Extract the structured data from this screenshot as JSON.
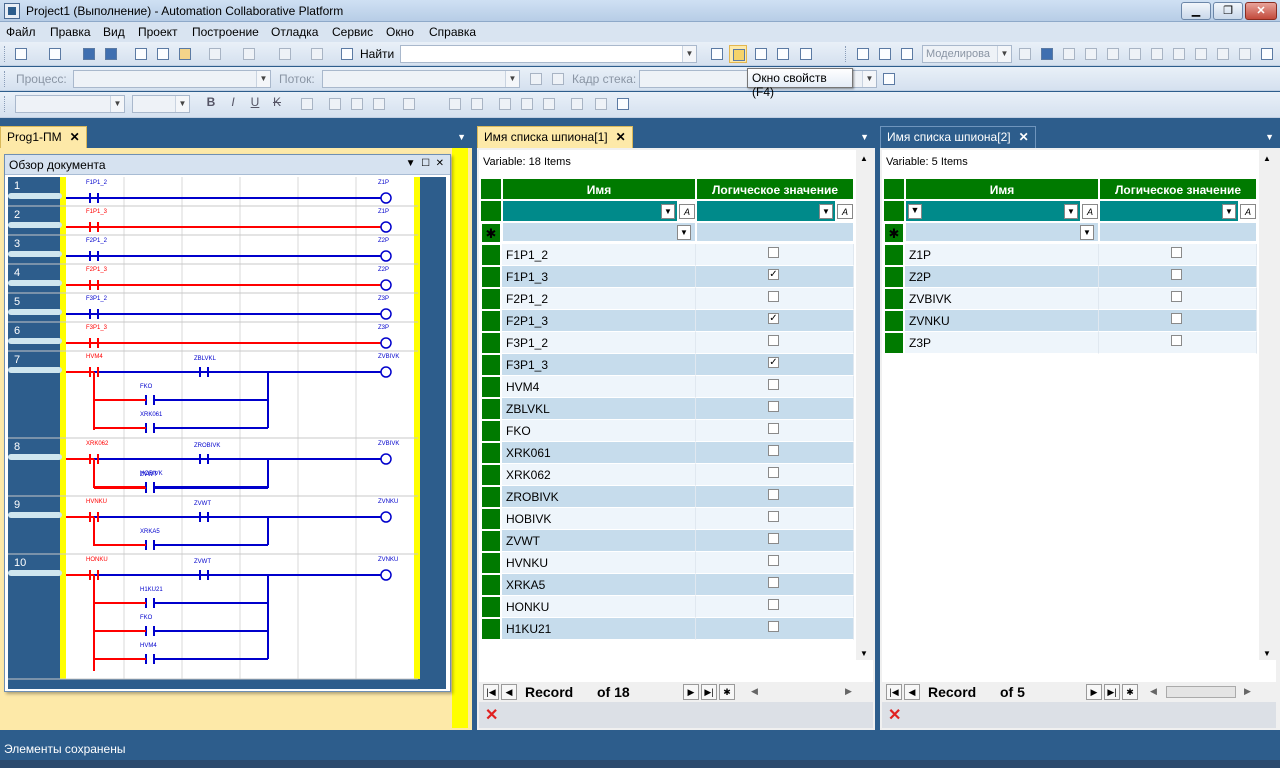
{
  "window": {
    "title": "Project1 (Выполнение) - Automation Collaborative Platform",
    "min": "▁",
    "max": "❐",
    "close": "✕"
  },
  "menu": [
    "Файл",
    "Правка",
    "Вид",
    "Проект",
    "Построение",
    "Отладка",
    "Сервис",
    "Окно",
    "Справка"
  ],
  "toolbar1": {
    "find_label": "Найти",
    "find_value": "",
    "model_combo": "Моделирова"
  },
  "toolbar2": {
    "process_label": "Процесс:",
    "process_value": "",
    "stream_label": "Поток:",
    "stream_value": "",
    "stack_label": "Кадр стека:",
    "stack_value": ""
  },
  "toolbar3": {
    "font": "",
    "size": "",
    "bold": "B",
    "italic": "I",
    "underline": "U",
    "strike": "K"
  },
  "tooltip": "Окно свойств (F4)",
  "left_panel": {
    "tab": "Prog1-ПМ",
    "overview_title": "Обзор документа",
    "rungs": [
      {
        "n": "1",
        "contacts": [
          "F1P1_2"
        ],
        "coil": "Z1P",
        "state": "blue"
      },
      {
        "n": "2",
        "contacts": [
          "F1P1_3"
        ],
        "coil": "Z1P",
        "state": "red"
      },
      {
        "n": "3",
        "contacts": [
          "F2P1_2"
        ],
        "coil": "Z2P",
        "state": "blue"
      },
      {
        "n": "4",
        "contacts": [
          "F2P1_3"
        ],
        "coil": "Z2P",
        "state": "red"
      },
      {
        "n": "5",
        "contacts": [
          "F3P1_2"
        ],
        "coil": "Z3P",
        "state": "blue"
      },
      {
        "n": "6",
        "contacts": [
          "F3P1_3"
        ],
        "coil": "Z3P",
        "state": "red"
      },
      {
        "n": "7",
        "contacts": [
          "HVM4",
          "ZBLVKL",
          "FKO",
          "XRK061"
        ],
        "coil": "ZVBIVK",
        "state": "mixed"
      },
      {
        "n": "8",
        "contacts": [
          "XRK062",
          "ZROBIVK",
          "HOBIVK",
          "ZVWT"
        ],
        "coil": "ZVBIVK",
        "state": "mixed"
      },
      {
        "n": "9",
        "contacts": [
          "HVNKU",
          "ZVWT",
          "XRKA5"
        ],
        "coil": "ZVNKU",
        "state": "mixed"
      },
      {
        "n": "10",
        "contacts": [
          "HONKU",
          "ZVWT",
          "H1KU21",
          "FKO",
          "HVM4"
        ],
        "coil": "ZVNKU",
        "state": "mixed"
      }
    ]
  },
  "watch1": {
    "tab": "Имя списка шпиона[1]",
    "variable_label": "Variable: 18 Items",
    "col_name": "Имя",
    "col_value": "Логическое значение",
    "rows": [
      {
        "name": "F1P1_2",
        "checked": false
      },
      {
        "name": "F1P1_3",
        "checked": true
      },
      {
        "name": "F2P1_2",
        "checked": false
      },
      {
        "name": "F2P1_3",
        "checked": true
      },
      {
        "name": "F3P1_2",
        "checked": false
      },
      {
        "name": "F3P1_3",
        "checked": true
      },
      {
        "name": "HVM4",
        "checked": false
      },
      {
        "name": "ZBLVKL",
        "checked": false
      },
      {
        "name": "FKO",
        "checked": false
      },
      {
        "name": "XRK061",
        "checked": false
      },
      {
        "name": "XRK062",
        "checked": false
      },
      {
        "name": "ZROBIVK",
        "checked": false
      },
      {
        "name": "HOBIVK",
        "checked": false
      },
      {
        "name": "ZVWT",
        "checked": false
      },
      {
        "name": "HVNKU",
        "checked": false
      },
      {
        "name": "XRKA5",
        "checked": false
      },
      {
        "name": "HONKU",
        "checked": false
      },
      {
        "name": "H1KU21",
        "checked": false
      }
    ],
    "nav_record": "Record",
    "nav_of": "of 18"
  },
  "watch2": {
    "tab": "Имя списка шпиона[2]",
    "variable_label": "Variable: 5 Items",
    "col_name": "Имя",
    "col_value": "Логическое значение",
    "rows": [
      {
        "name": "Z1P",
        "checked": false
      },
      {
        "name": "Z2P",
        "checked": false
      },
      {
        "name": "ZVBIVK",
        "checked": false
      },
      {
        "name": "ZVNKU",
        "checked": false
      },
      {
        "name": "Z3P",
        "checked": false
      }
    ],
    "nav_record": "Record",
    "nav_of": "of 5"
  },
  "status": "Элементы сохранены",
  "colors": {
    "grid_header": "#007a00",
    "filter_row": "#008a8a",
    "row_alt": "#c6dcec",
    "live_wire_red": "#ff0000",
    "wire_blue": "#0000cc"
  }
}
